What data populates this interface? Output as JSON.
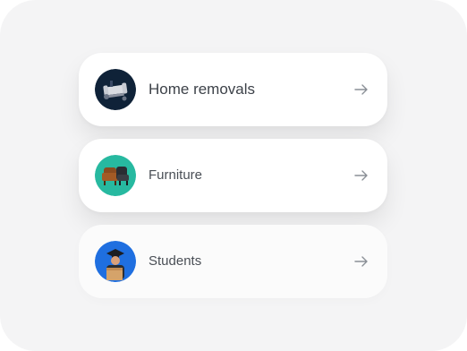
{
  "services": {
    "items": [
      {
        "label": "Home removals",
        "icon": "couch-icon",
        "avatar_bg": "#0f2238"
      },
      {
        "label": "Furniture",
        "icon": "armchair-icon",
        "avatar_bg": "#27b9a0"
      },
      {
        "label": "Students",
        "icon": "student-icon",
        "avatar_bg": "#1f6fe0"
      }
    ],
    "arrow_icon": "arrow-right-icon"
  },
  "colors": {
    "panel_bg": "#f4f4f5",
    "card_bg": "#ffffff",
    "text": "#3d4249",
    "arrow": "#8a8f96"
  }
}
